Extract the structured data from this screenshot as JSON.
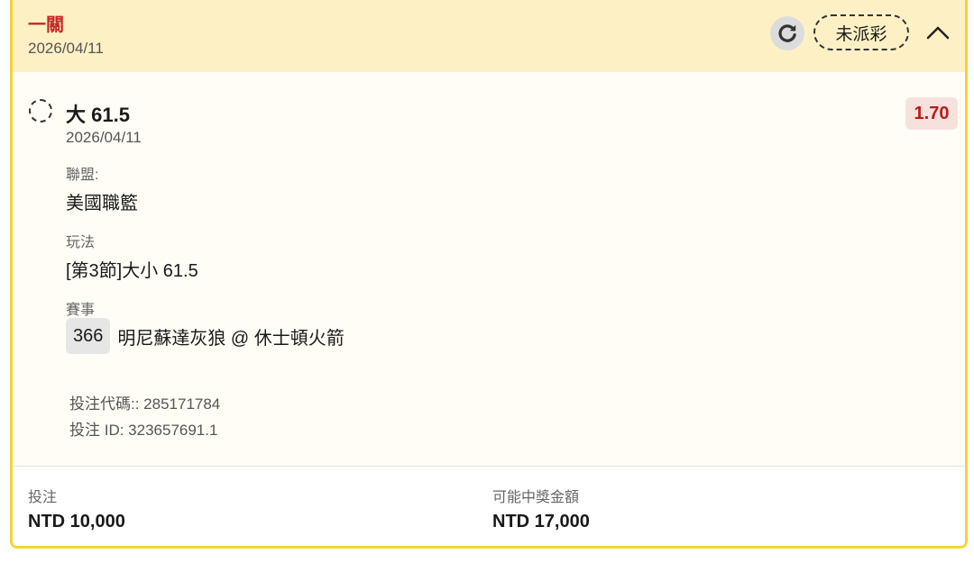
{
  "header": {
    "bet_type": "一關",
    "date": "2026/04/11",
    "status": "未派彩",
    "refresh_icon": "refresh-icon",
    "collapse_icon": "chevron-up-icon"
  },
  "selection": {
    "name": "大 61.5",
    "odds": "1.70",
    "date": "2026/04/11",
    "league_label": "聯盟:",
    "league": "美國職籃",
    "market_label": "玩法",
    "market": "[第3節]大小 61.5",
    "event_label": "賽事",
    "event_number": "366",
    "event": "明尼蘇達灰狼 @ 休士頓火箭"
  },
  "codes": {
    "bet_code": "投注代碼:: 285171784",
    "bet_id": "投注 ID: 323657691.1"
  },
  "footer": {
    "stake_label": "投注",
    "stake": "NTD 10,000",
    "payout_label": "可能中獎金額",
    "payout": "NTD 17,000"
  },
  "colors": {
    "header_bg": "#fdf0c4",
    "border": "#f5d23a",
    "accent_red": "#c62828",
    "odds_bg": "#f7e1dd"
  }
}
